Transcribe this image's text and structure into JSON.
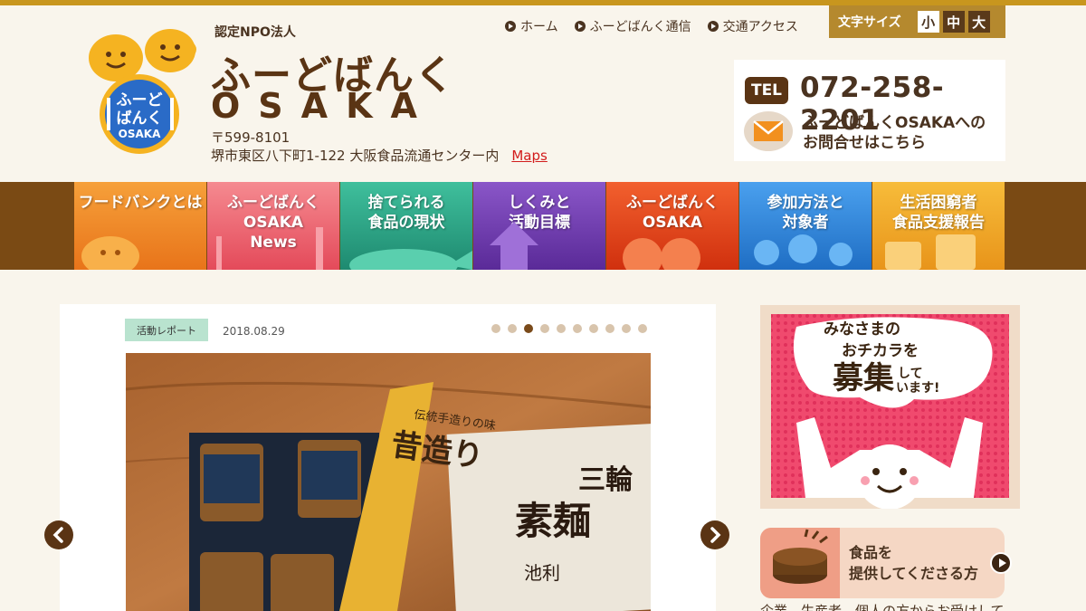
{
  "header": {
    "org_type": "認定NPO法人",
    "brand_jp": "ふーどばんく",
    "brand_en": "OSAKA",
    "logo_text_1": "ふーど",
    "logo_text_2": "ばんく",
    "logo_text_3": "OSAKA",
    "zip": "〒599-8101",
    "address": "堺市東区八下町1-122 大阪食品流通センター内",
    "maps_label": "Maps"
  },
  "topnav": [
    {
      "label": "ホーム"
    },
    {
      "label": "ふーどばんく通信"
    },
    {
      "label": "交通アクセス"
    }
  ],
  "fontsize": {
    "label": "文字サイズ",
    "small": "小",
    "medium": "中",
    "large": "大"
  },
  "contact": {
    "tel_badge": "TEL",
    "tel": "072-258-2201",
    "mail_text": "ふーどばんくOSAKAへの\nお問合せはこちら"
  },
  "mainnav": [
    {
      "label": "フードバンクとは",
      "color": "#f08a1c"
    },
    {
      "label": "ふーどばんく\nOSAKA\nNews",
      "color": "#ee5d6c"
    },
    {
      "label": "捨てられる\n食品の現状",
      "color": "#2ea58a"
    },
    {
      "label": "しくみと\n活動目標",
      "color": "#6a3aa8"
    },
    {
      "label": "ふーどばんく\nOSAKA",
      "color": "#e8401c"
    },
    {
      "label": "参加方法と\n対象者",
      "color": "#2f86d8"
    },
    {
      "label": "生活困窮者\n食品支援報告",
      "color": "#f0a818"
    }
  ],
  "slider": {
    "tag": "活動レポート",
    "date": "2018.08.29",
    "dot_count": 10,
    "active_dot": 2,
    "photo_text_1": "伝統手造りの味",
    "photo_text_2": "昔造り",
    "photo_text_3": "素麺",
    "photo_text_4": "三輪",
    "photo_text_5": "池利"
  },
  "banner": {
    "line1": "みなさまの",
    "line2": "おチカラを",
    "big": "募集",
    "tail1": "して",
    "tail2": "います!"
  },
  "provide": {
    "label": "食品を\n提供してくださる方",
    "subtext": "企業、生産者、個人の方からお受けして"
  }
}
